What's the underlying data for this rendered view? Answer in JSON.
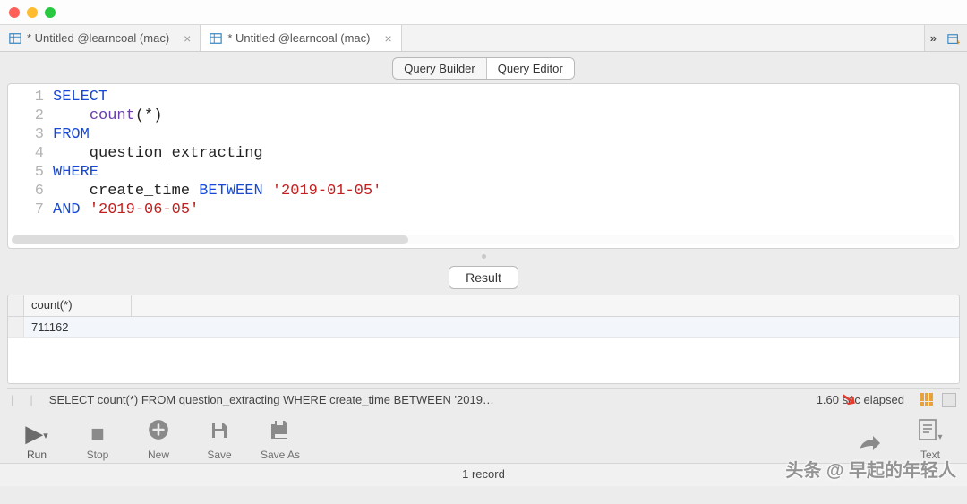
{
  "tabs": [
    {
      "label": "* Untitled @learncoal (mac)",
      "active": false
    },
    {
      "label": "* Untitled @learncoal (mac)",
      "active": true
    }
  ],
  "segmented": {
    "builder": "Query Builder",
    "editor": "Query Editor",
    "active": "editor"
  },
  "code": {
    "lines": [
      {
        "n": "1",
        "html": "<span class='kw'>SELECT</span>"
      },
      {
        "n": "2",
        "html": "    <span class='fn'>count</span>(*)"
      },
      {
        "n": "3",
        "html": "<span class='kw'>FROM</span>"
      },
      {
        "n": "4",
        "html": "    question_extracting"
      },
      {
        "n": "5",
        "html": "<span class='kw'>WHERE</span>"
      },
      {
        "n": "6",
        "html": "    create_time <span class='kw'>BETWEEN</span> <span class='str'>'2019-01-05'</span>"
      },
      {
        "n": "7",
        "html": "<span class='kw'>AND</span> <span class='str'>'2019-06-05'</span>"
      }
    ]
  },
  "result_button": "Result",
  "grid": {
    "columns": [
      "count(*)"
    ],
    "rows": [
      [
        "711162"
      ]
    ]
  },
  "status": {
    "query": "SELECT     count(*) FROM  question_extracting WHERE      create_time BETWEEN '2019…",
    "elapsed": "1.60 sec elapsed"
  },
  "toolbar": {
    "run": "Run",
    "stop": "Stop",
    "new": "New",
    "save": "Save",
    "saveas": "Save As",
    "share": "",
    "text": "Text"
  },
  "footer": {
    "records": "1 record"
  },
  "watermark": "头条 @ 早起的年轻人"
}
